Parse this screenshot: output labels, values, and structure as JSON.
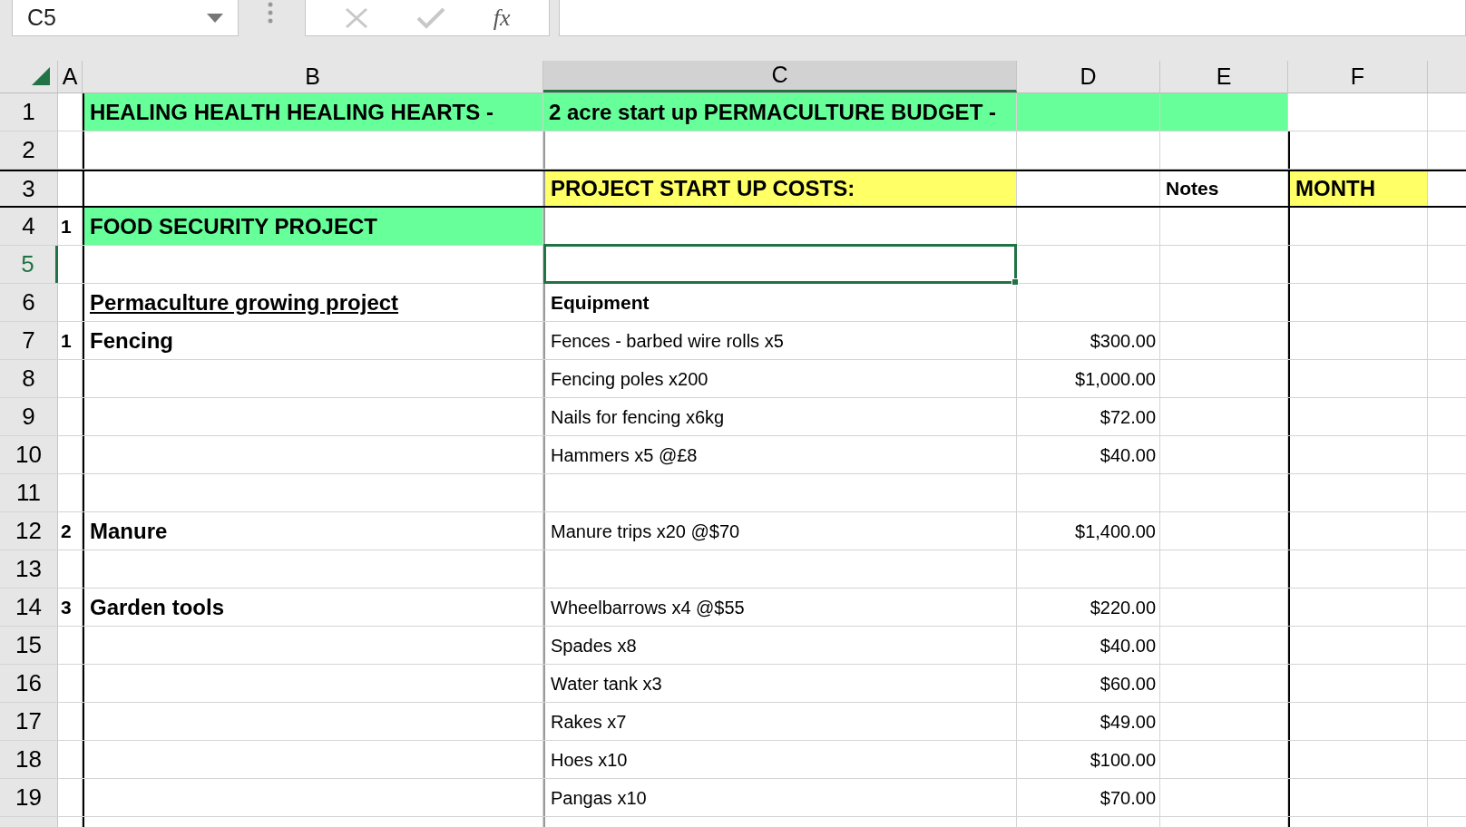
{
  "name_box": "C5",
  "formula_buttons": {
    "function": "fx"
  },
  "columns": [
    {
      "label": "A",
      "selected": false
    },
    {
      "label": "B",
      "selected": false
    },
    {
      "label": "C",
      "selected": true
    },
    {
      "label": "D",
      "selected": false
    },
    {
      "label": "E",
      "selected": false
    },
    {
      "label": "F",
      "selected": false
    }
  ],
  "rows": [
    {
      "number": "1",
      "selected": false,
      "cells": [
        null,
        {
          "text": "HEALING HEALTH HEALING HEARTS -",
          "color": "#66ff99"
        },
        {
          "text": "2 acre start up PERMACULTURE BUDGET -",
          "color": "#66ff99"
        },
        {
          "color": "#66ff99"
        },
        {
          "color": "#66ff99"
        },
        null
      ]
    },
    {
      "number": "2",
      "selected": false,
      "cells": [
        null,
        null,
        null,
        null,
        null,
        null
      ]
    },
    {
      "number": "3",
      "selected": false,
      "cells": [
        null,
        null,
        {
          "text": "PROJECT START UP COSTS:",
          "color": "#ffff66"
        },
        null,
        {
          "text": "Notes",
          "bold": true
        },
        {
          "text": "MONTH",
          "color": "#ffff66"
        }
      ]
    },
    {
      "number": "4",
      "selected": false,
      "cells": [
        {
          "text": "1"
        },
        {
          "text": "FOOD SECURITY PROJECT",
          "color": "#66ff99"
        },
        null,
        null,
        null,
        null
      ]
    },
    {
      "number": "5",
      "selected": true,
      "cells": [
        null,
        null,
        {
          "selected": true
        },
        null,
        null,
        null
      ]
    },
    {
      "number": "6",
      "selected": false,
      "cells": [
        null,
        {
          "text": "Permaculture growing project ",
          "underline": true
        },
        {
          "text": "Equipment",
          "bold": true
        },
        null,
        null,
        null
      ]
    },
    {
      "number": "7",
      "selected": false,
      "cells": [
        {
          "text": "1"
        },
        {
          "text": "Fencing"
        },
        {
          "text": "Fences - barbed wire rolls x5"
        },
        {
          "text": "$300.00"
        },
        null,
        null
      ]
    },
    {
      "number": "8",
      "selected": false,
      "cells": [
        null,
        null,
        {
          "text": "Fencing poles x200"
        },
        {
          "text": "$1,000.00"
        },
        null,
        null
      ]
    },
    {
      "number": "9",
      "selected": false,
      "cells": [
        null,
        null,
        {
          "text": "Nails for fencing x6kg"
        },
        {
          "text": "$72.00"
        },
        null,
        null
      ]
    },
    {
      "number": "10",
      "selected": false,
      "cells": [
        null,
        null,
        {
          "text": "Hammers x5 @£8"
        },
        {
          "text": "$40.00"
        },
        null,
        null
      ]
    },
    {
      "number": "11",
      "selected": false,
      "cells": [
        null,
        null,
        null,
        null,
        null,
        null
      ]
    },
    {
      "number": "12",
      "selected": false,
      "cells": [
        {
          "text": "2"
        },
        {
          "text": "Manure"
        },
        {
          "text": "Manure trips x20 @$70"
        },
        {
          "text": "$1,400.00"
        },
        null,
        null
      ]
    },
    {
      "number": "13",
      "selected": false,
      "cells": [
        null,
        null,
        null,
        null,
        null,
        null
      ]
    },
    {
      "number": "14",
      "selected": false,
      "cells": [
        {
          "text": "3"
        },
        {
          "text": "Garden tools"
        },
        {
          "text": "Wheelbarrows x4 @$55"
        },
        {
          "text": "$220.00"
        },
        null,
        null
      ]
    },
    {
      "number": "15",
      "selected": false,
      "cells": [
        null,
        null,
        {
          "text": "Spades x8"
        },
        {
          "text": "$40.00"
        },
        null,
        null
      ]
    },
    {
      "number": "16",
      "selected": false,
      "cells": [
        null,
        null,
        {
          "text": "Water tank x3"
        },
        {
          "text": "$60.00"
        },
        null,
        null
      ]
    },
    {
      "number": "17",
      "selected": false,
      "cells": [
        null,
        null,
        {
          "text": "Rakes x7"
        },
        {
          "text": "$49.00"
        },
        null,
        null
      ]
    },
    {
      "number": "18",
      "selected": false,
      "cells": [
        null,
        null,
        {
          "text": "Hoes x10"
        },
        {
          "text": "$100.00"
        },
        null,
        null
      ]
    },
    {
      "number": "19",
      "selected": false,
      "cells": [
        null,
        null,
        {
          "text": "Pangas x10"
        },
        {
          "text": "$70.00"
        },
        null,
        null
      ]
    }
  ]
}
